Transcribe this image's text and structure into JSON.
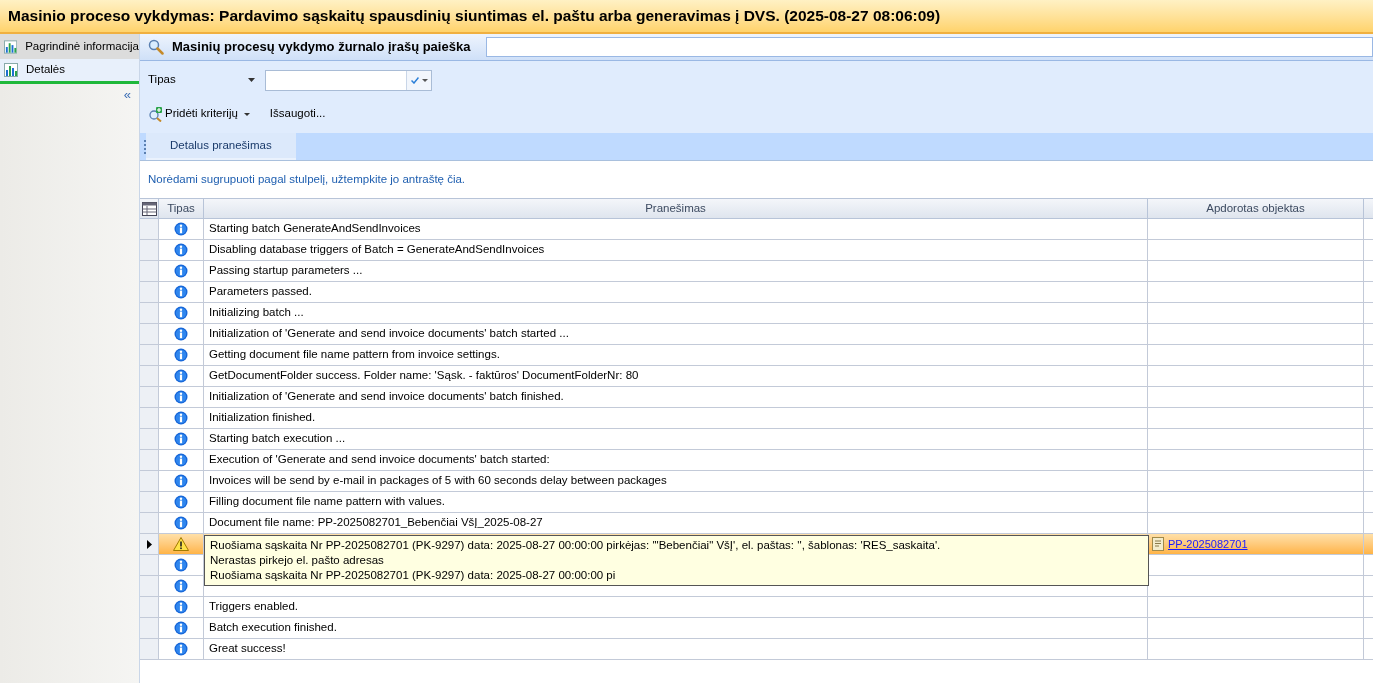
{
  "window": {
    "title": "Masinio proceso vykdymas: Pardavimo sąskaitų spausdinių siuntimas el. paštu arba generavimas į DVS. (2025-08-27 08:06:09)"
  },
  "sidebar": {
    "items": [
      {
        "label": "Pagrindinė informacija",
        "selected": false,
        "hovered": true
      },
      {
        "label": "Detalės",
        "selected": true,
        "hovered": false
      }
    ],
    "collapse": "«"
  },
  "search": {
    "title": "Masinių procesų vykdymo žurnalo įrašų paieška"
  },
  "filter": {
    "label": "Tipas",
    "add_criteria": "Pridėti kriterijų",
    "save": "Išsaugoti..."
  },
  "tabs": [
    {
      "label": "Detalus pranešimas",
      "selected": true
    }
  ],
  "group_hint": "Norėdami sugrupuoti pagal stulpelį, užtempkite jo antraštę čia.",
  "table": {
    "columns": [
      "Tipas",
      "Pranešimas",
      "Apdorotas objektas"
    ],
    "rows": [
      {
        "kind": "info",
        "selected": false,
        "message": "Starting batch GenerateAndSendInvoices"
      },
      {
        "kind": "info",
        "selected": false,
        "message": "Disabling database triggers of Batch = GenerateAndSendInvoices"
      },
      {
        "kind": "info",
        "selected": false,
        "message": "Passing startup parameters ..."
      },
      {
        "kind": "info",
        "selected": false,
        "message": "Parameters passed."
      },
      {
        "kind": "info",
        "selected": false,
        "message": "Initializing batch ..."
      },
      {
        "kind": "info",
        "selected": false,
        "message": "Initialization of 'Generate and send invoice documents' batch started ..."
      },
      {
        "kind": "info",
        "selected": false,
        "message": "Getting document file name pattern from invoice settings."
      },
      {
        "kind": "info",
        "selected": false,
        "message": "GetDocumentFolder success. Folder name: 'Sąsk. - faktūros' DocumentFolderNr: 80"
      },
      {
        "kind": "info",
        "selected": false,
        "message": "Initialization of 'Generate and send invoice documents' batch finished."
      },
      {
        "kind": "info",
        "selected": false,
        "message": "Initialization finished."
      },
      {
        "kind": "info",
        "selected": false,
        "message": "Starting batch execution ..."
      },
      {
        "kind": "info",
        "selected": false,
        "message": "Execution of 'Generate and send invoice documents' batch started:"
      },
      {
        "kind": "info",
        "selected": false,
        "message": "Invoices will be send by e-mail in packages of 5 with 60 seconds delay between packages"
      },
      {
        "kind": "info",
        "selected": false,
        "message": "Filling document file name pattern with values."
      },
      {
        "kind": "info",
        "selected": false,
        "message": "Document file name: PP-2025082701_Bebenčiai VšĮ_2025-08-27"
      },
      {
        "kind": "warning",
        "selected": true,
        "object": "PP-2025082701"
      },
      {
        "kind": "info",
        "selected": false
      },
      {
        "kind": "info",
        "selected": false
      },
      {
        "kind": "info",
        "selected": false,
        "message": "Triggers enabled."
      },
      {
        "kind": "info",
        "selected": false,
        "message": "Batch execution finished."
      },
      {
        "kind": "info",
        "selected": false,
        "message": "Great success!"
      }
    ]
  },
  "tooltip": {
    "lines": [
      "Ruošiama sąskaita Nr PP-2025082701 (PK-9297) data: 2025-08-27 00:00:00  pirkėjas: '\"Bebenčiai\" VšĮ', el. paštas: '', šablonas: 'RES_saskaita'.",
      "Nerastas pirkejo el. pašto adresas",
      "Ruošiama sąskaita Nr PP-2025082701 (PK-9297) data: 2025-08-27 00:00:00  pi"
    ]
  }
}
